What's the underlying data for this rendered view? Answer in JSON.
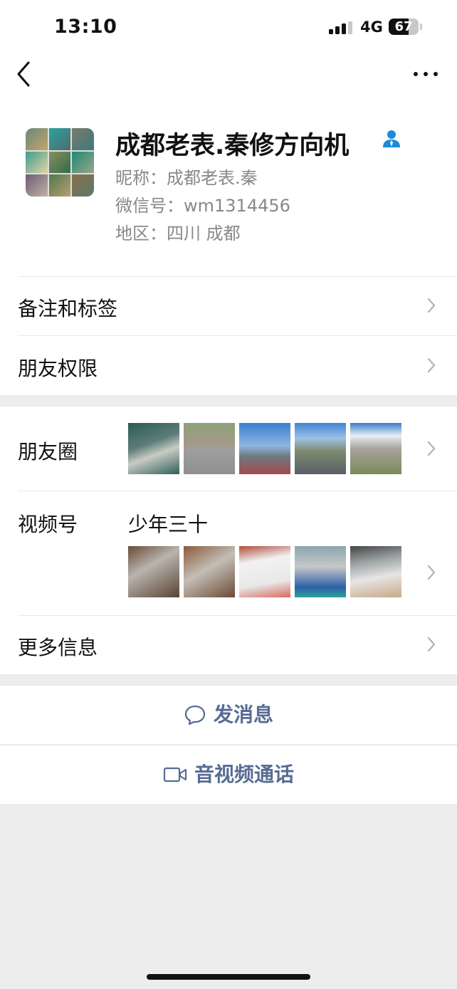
{
  "status_bar": {
    "time": "13:10",
    "network": "4G",
    "battery_level": 67,
    "battery_label": "67"
  },
  "nav": {
    "back_icon": "chevron-left-icon",
    "more_icon": "more-dots-icon"
  },
  "profile": {
    "display_name": "成都老表.秦修方向机",
    "verify_icon": "person-icon",
    "nickname_line": "昵称：成都老表.秦",
    "wechat_id_line": "微信号：wm1314456",
    "region_line": "地区：四川 成都"
  },
  "rows": {
    "notes_tags": "备注和标签",
    "friend_permissions": "朋友权限",
    "moments": "朋友圈",
    "channels": "视频号",
    "channel_name": "少年三十",
    "more_info": "更多信息"
  },
  "actions": {
    "send_message": "发消息",
    "av_call": "音视频通话"
  },
  "colors": {
    "link_blue": "#576b95",
    "verify_blue": "#1c8ad9",
    "background_gray": "#ededed"
  }
}
